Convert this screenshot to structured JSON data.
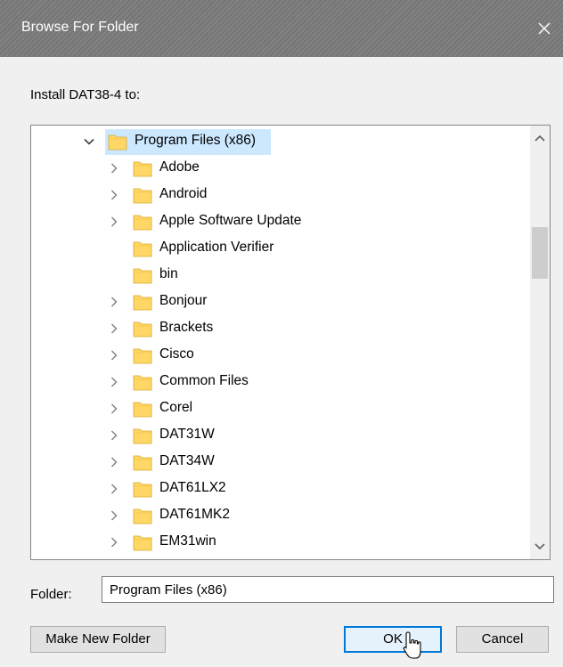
{
  "window": {
    "title": "Browse For Folder"
  },
  "prompt": "Install DAT38-4 to:",
  "tree": {
    "items": [
      {
        "label": "Program Files (x86)",
        "expanded": true,
        "selected": true,
        "level": 0
      },
      {
        "label": "Adobe",
        "has_children": true,
        "level": 1
      },
      {
        "label": "Android",
        "has_children": true,
        "level": 1
      },
      {
        "label": "Apple Software Update",
        "has_children": true,
        "level": 1
      },
      {
        "label": "Application Verifier",
        "has_children": false,
        "level": 1
      },
      {
        "label": "bin",
        "has_children": false,
        "level": 1
      },
      {
        "label": "Bonjour",
        "has_children": true,
        "level": 1
      },
      {
        "label": "Brackets",
        "has_children": true,
        "level": 1
      },
      {
        "label": "Cisco",
        "has_children": true,
        "level": 1
      },
      {
        "label": "Common Files",
        "has_children": true,
        "level": 1
      },
      {
        "label": "Corel",
        "has_children": true,
        "level": 1
      },
      {
        "label": "DAT31W",
        "has_children": true,
        "level": 1
      },
      {
        "label": "DAT34W",
        "has_children": true,
        "level": 1
      },
      {
        "label": "DAT61LX2",
        "has_children": true,
        "level": 1
      },
      {
        "label": "DAT61MK2",
        "has_children": true,
        "level": 1
      },
      {
        "label": "EM31win",
        "has_children": true,
        "level": 1
      }
    ]
  },
  "folder_field": {
    "label": "Folder:",
    "value": "Program Files (x86)"
  },
  "buttons": {
    "make_new_folder": "Make New Folder",
    "ok": "OK",
    "cancel": "Cancel"
  },
  "colors": {
    "titlebar": "#7b7b7b",
    "selection": "#cce8ff",
    "folder": "#ffd767",
    "focus_border": "#0078d7"
  }
}
